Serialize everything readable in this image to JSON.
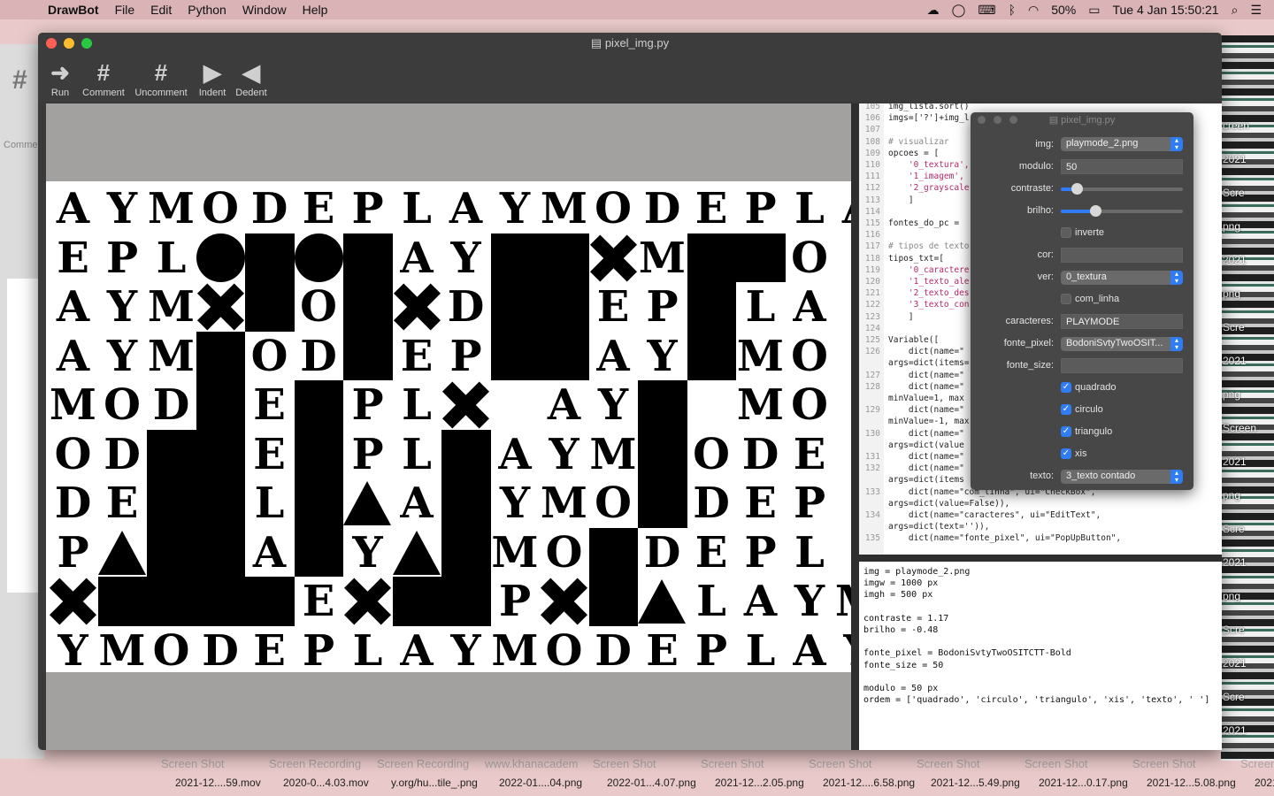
{
  "menubar": {
    "app": "DrawBot",
    "items": [
      "File",
      "Edit",
      "Python",
      "Window",
      "Help"
    ],
    "battery": "50%",
    "clock": "Tue 4 Jan  15:50:21"
  },
  "window": {
    "title": "pixel_img.py",
    "toolbar": {
      "run": "Run",
      "comment": "Comment",
      "uncomment": "Uncomment",
      "indent": "Indent",
      "dedent": "Dedent"
    }
  },
  "background_window": {
    "comment_label": "Comme"
  },
  "artwork": {
    "rows": [
      "AYMODEPLAYMODEPLA",
      "EPL__A Y__M_O",
      "AYM_O_D_EP L A",
      "AYM_OD_EP LAY_MO",
      "MOD_E_PL AY_MO",
      "OD__E_PL_AYM_ODE",
      "DE_PL_A_YMO_DEP",
      "P__LA_Y_MO_DEPL",
      "__E_P___LAYM",
      "YMODEPLAYMODEPLA"
    ]
  },
  "code": {
    "lines": [
      {
        "n": "105",
        "t": "img_lista.sort()"
      },
      {
        "n": "106",
        "t": "imgs=['?']+img_l"
      },
      {
        "n": "107",
        "t": ""
      },
      {
        "n": "108",
        "t": "# visualizar"
      },
      {
        "n": "109",
        "t": "opcoes = ["
      },
      {
        "n": "110",
        "t": "    '0_textura',"
      },
      {
        "n": "111",
        "t": "    '1_imagem',"
      },
      {
        "n": "112",
        "t": "    '2_grayscale"
      },
      {
        "n": "113",
        "t": "    ]"
      },
      {
        "n": "114",
        "t": ""
      },
      {
        "n": "115",
        "t": "fontes_do_pc = "
      },
      {
        "n": "116",
        "t": ""
      },
      {
        "n": "117",
        "t": "# tipos de texto"
      },
      {
        "n": "118",
        "t": "tipos_txt=["
      },
      {
        "n": "119",
        "t": "    '0_caractere"
      },
      {
        "n": "120",
        "t": "    '1_texto_ale"
      },
      {
        "n": "121",
        "t": "    '2_texto_des"
      },
      {
        "n": "122",
        "t": "    '3_texto_con"
      },
      {
        "n": "123",
        "t": "    ]"
      },
      {
        "n": "124",
        "t": ""
      },
      {
        "n": "125",
        "t": "Variable(["
      },
      {
        "n": "126",
        "t": "    dict(name=\""
      },
      {
        "n": "",
        "t": "args=dict(items="
      },
      {
        "n": "127",
        "t": "    dict(name=\""
      },
      {
        "n": "128",
        "t": "    dict(name=\""
      },
      {
        "n": "",
        "t": "minValue=1, max"
      },
      {
        "n": "129",
        "t": "    dict(name=\""
      },
      {
        "n": "",
        "t": "minValue=-1, max"
      },
      {
        "n": "130",
        "t": "    dict(name=\""
      },
      {
        "n": "",
        "t": "args=dict(value"
      },
      {
        "n": "131",
        "t": "    dict(name=\""
      },
      {
        "n": "132",
        "t": "    dict(name=\""
      },
      {
        "n": "",
        "t": "args=dict(items"
      },
      {
        "n": "133",
        "t": "    dict(name=\"com_linha\", ui=\"CheckBox\","
      },
      {
        "n": "",
        "t": "args=dict(value=False)),"
      },
      {
        "n": "134",
        "t": "    dict(name=\"caracteres\", ui=\"EditText\","
      },
      {
        "n": "",
        "t": "args=dict(text='')),"
      },
      {
        "n": "135",
        "t": "    dict(name=\"fonte_pixel\", ui=\"PopUpButton\","
      }
    ],
    "overflow_right": [
      "')),",
      ","
    ]
  },
  "output": {
    "lines": [
      "img = playmode_2.png",
      "imgw = 1000 px",
      "imgh = 500 px",
      "",
      "contraste = 1.17",
      "brilho = -0.48",
      "",
      "fonte_pixel = BodoniSvtyTwoOSITCTT-Bold",
      "fonte_size = 50",
      "",
      "modulo = 50 px",
      "ordem = ['quadrado', 'circulo', 'triangulo', 'xis', 'texto', ' ']"
    ]
  },
  "panel": {
    "title": "pixel_img.py",
    "img_label": "img:",
    "img_value": "playmode_2.png",
    "modulo_label": "modulo:",
    "modulo_value": "50",
    "contraste_label": "contraste:",
    "contraste_value": 0.13,
    "brilho_label": "brilho:",
    "brilho_value": 0.28,
    "inverte_label": "inverte",
    "inverte_checked": false,
    "cor_label": "cor:",
    "cor_value": "",
    "ver_label": "ver:",
    "ver_value": "0_textura",
    "com_linha_label": "com_linha",
    "com_linha_checked": false,
    "caracteres_label": "caracteres:",
    "caracteres_value": "PLAYMODE",
    "fonte_pixel_label": "fonte_pixel:",
    "fonte_pixel_value": "BodoniSvtyTwoOSIT...",
    "fonte_size_label": "fonte_size:",
    "fonte_size_value": "",
    "quadrado_label": "quadrado",
    "circulo_label": "circulo",
    "triangulo_label": "triangulo",
    "xis_label": "xis",
    "texto_label": "texto:",
    "texto_value": "3_texto contado"
  },
  "desktop_files": [
    "2021-12....59.mov",
    "2020-0...4.03.mov",
    "y.org/hu...tile_.png",
    "2022-01....04.png",
    "2022-01...4.07.png",
    "2021-12...2.05.png",
    "2021-12....6.58.png",
    "2021-12...5.49.png",
    "2021-12...0.17.png",
    "2021-12...5.08.png",
    "2021"
  ],
  "desktop_ghosts": [
    "Screen Shot",
    "Screen Recording",
    "Screen Recording",
    "www.khanacadem",
    "Screen Shot",
    "Screen Shot",
    "Screen Shot",
    "Screen Shot",
    "Screen Shot",
    "Screen Shot",
    "Screen Shot"
  ],
  "thumb_labels": [
    "creen",
    "2021",
    "Scre",
    "png",
    "2021",
    "png",
    "Scre",
    "2021",
    "png",
    "Screen",
    "2021",
    "png",
    "Scre",
    "2021",
    "png",
    "Scre",
    "2021",
    "Scre",
    "2021"
  ]
}
